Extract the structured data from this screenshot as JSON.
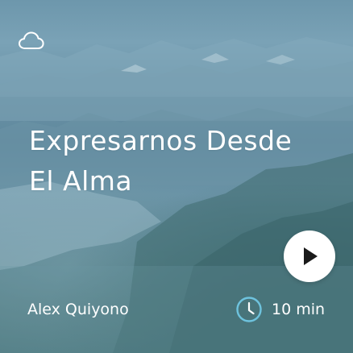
{
  "card": {
    "title": "Expresarnos Desde El Alma",
    "author": "Alex Quiyono",
    "duration": "10 min",
    "icons": {
      "weather": "cloud-icon",
      "play": "play-icon",
      "time": "clock-icon"
    },
    "colors": {
      "text": "#ffffff",
      "play_button_bg": "#ffffff",
      "play_icon": "#1a1a1a",
      "clock_accent": "#6ec3de"
    }
  }
}
